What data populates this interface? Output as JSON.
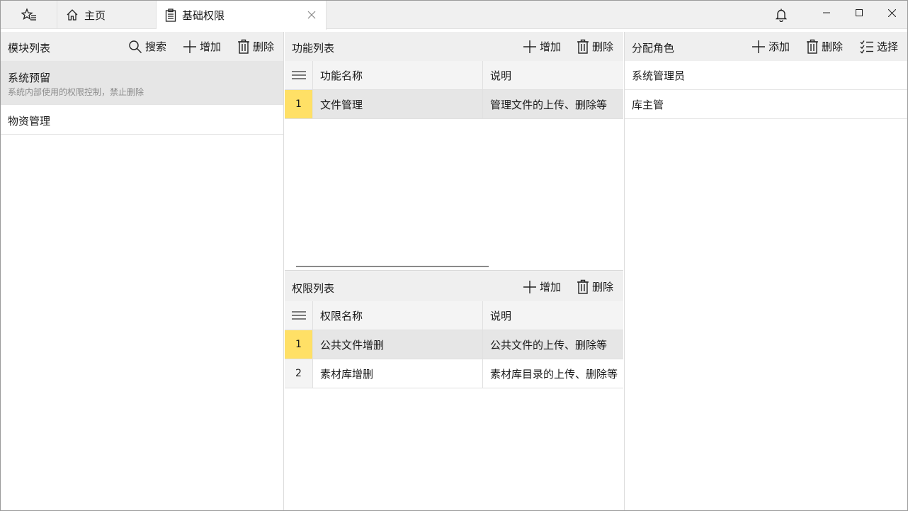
{
  "titlebar": {
    "tabs": [
      {
        "label": "主页",
        "icon": "home-icon"
      },
      {
        "label": "基础权限",
        "icon": "clipboard-icon"
      }
    ]
  },
  "modules": {
    "title": "模块列表",
    "buttons": {
      "search": "搜索",
      "add": "增加",
      "delete": "删除"
    },
    "items": [
      {
        "name": "系统预留",
        "desc": "系统内部使用的权限控制，禁止删除"
      },
      {
        "name": "物资管理"
      }
    ]
  },
  "functions": {
    "title": "功能列表",
    "buttons": {
      "add": "增加",
      "delete": "删除"
    },
    "columns": {
      "name": "功能名称",
      "desc": "说明"
    },
    "rows": [
      {
        "index": "1",
        "name": "文件管理",
        "desc": "管理文件的上传、删除等"
      }
    ]
  },
  "permissions": {
    "title": "权限列表",
    "buttons": {
      "add": "增加",
      "delete": "删除"
    },
    "columns": {
      "name": "权限名称",
      "desc": "说明"
    },
    "rows": [
      {
        "index": "1",
        "name": "公共文件增删",
        "desc": "公共文件的上传、删除等"
      },
      {
        "index": "2",
        "name": "素材库增删",
        "desc": "素材库目录的上传、删除等"
      }
    ]
  },
  "roles": {
    "title": "分配角色",
    "buttons": {
      "add": "添加",
      "delete": "删除",
      "select": "选择"
    },
    "items": [
      {
        "name": "系统管理员"
      },
      {
        "name": "库主管"
      }
    ]
  },
  "colors": {
    "selected_index": "#ffe066",
    "selected_row": "#e6e6e6",
    "header_bg": "#efefef"
  }
}
